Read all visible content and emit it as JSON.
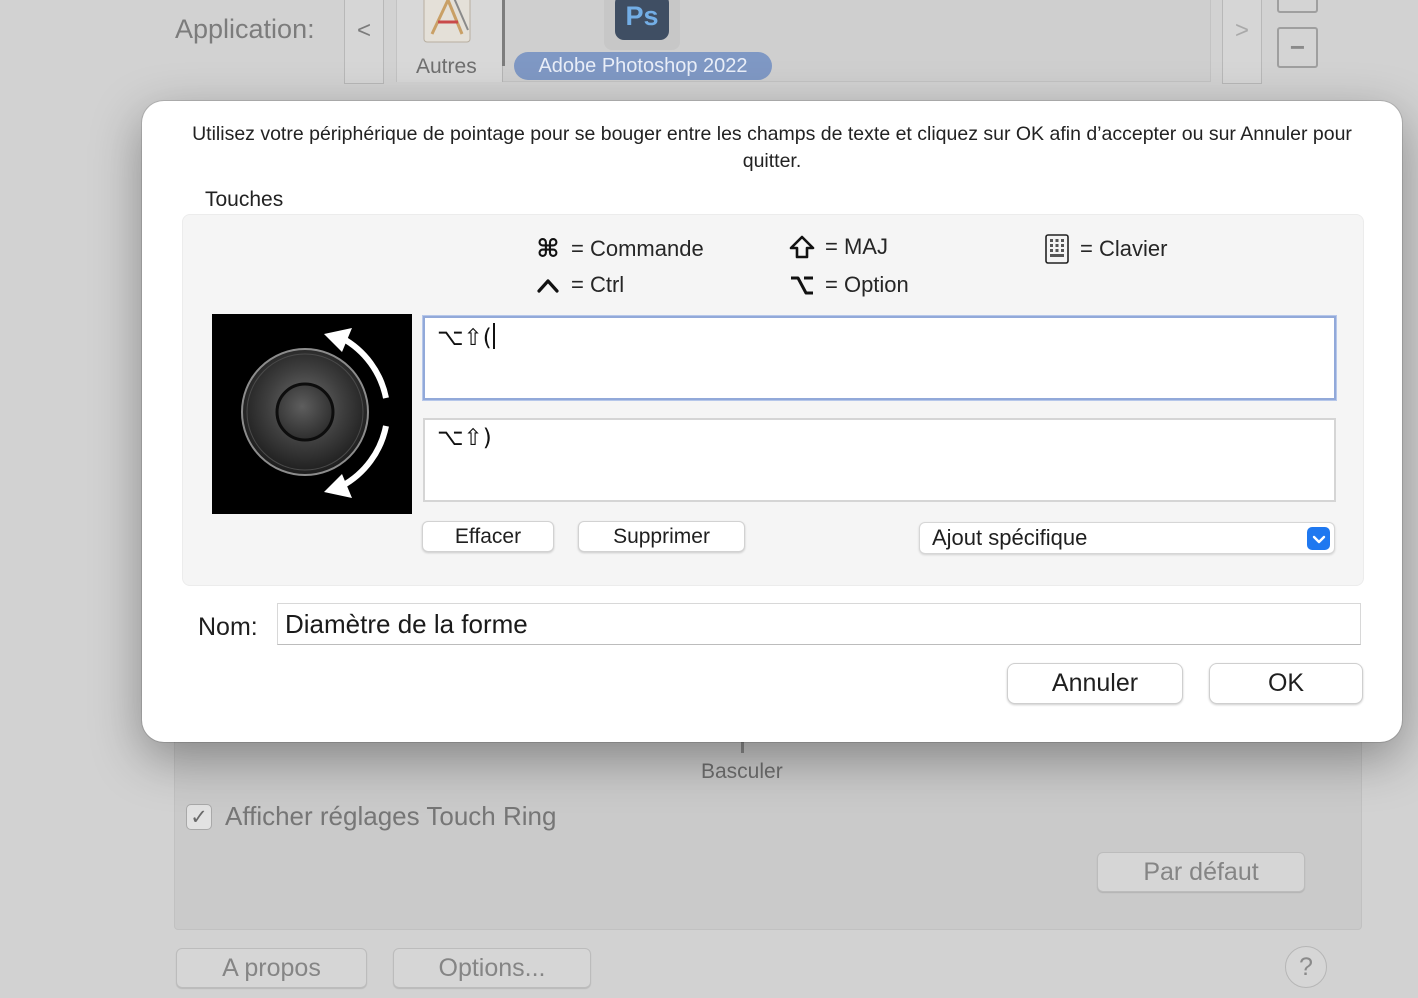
{
  "background": {
    "application_label": "Application:",
    "nav_prev": "<",
    "nav_next": ">",
    "apps": [
      {
        "label": "Autres"
      },
      {
        "label": "Adobe Photoshop 2022",
        "icon_text": "Ps",
        "selected": true
      }
    ],
    "add_button": "+",
    "remove_button": "−",
    "rotate_label": "Basculer",
    "touch_ring_checkbox": {
      "label": "Afficher réglages Touch Ring",
      "checked": true,
      "check_glyph": "✓"
    },
    "default_button": "Par défaut",
    "about_button": "A propos",
    "options_button": "Options...",
    "help_button": "?"
  },
  "dialog": {
    "instructions": "Utilisez votre périphérique de pointage pour se bouger entre les champs de texte et cliquez sur OK afin d’accepter ou sur Annuler pour quitter.",
    "keys_group_title": "Touches",
    "legend": [
      {
        "icon": "command-icon",
        "symbol": "⌘",
        "label": "= Commande"
      },
      {
        "icon": "shift-icon",
        "symbol": "⇧",
        "label": "= MAJ"
      },
      {
        "icon": "keyboard-icon",
        "symbol": "",
        "label": "= Clavier"
      },
      {
        "icon": "control-icon",
        "symbol": "^",
        "label": "= Ctrl"
      },
      {
        "icon": "option-icon",
        "symbol": "⌥",
        "label": "= Option"
      }
    ],
    "preview_icon": "touch-ring-rotation-icon",
    "keystroke_clockwise": "⌥⇧(",
    "keystroke_counterclockwise": "⌥⇧)",
    "clear_button": "Effacer",
    "delete_button": "Supprimer",
    "special_add_select": "Ajout spécifique",
    "name_label": "Nom:",
    "name_value": "Diamètre de la forme",
    "cancel_button": "Annuler",
    "ok_button": "OK"
  },
  "colors": {
    "accent": "#1f78f0",
    "focus_ring": "#92a9d9",
    "selected_app_pill": "#7f98c4",
    "photoshop_icon_bg": "#3f4e63"
  }
}
